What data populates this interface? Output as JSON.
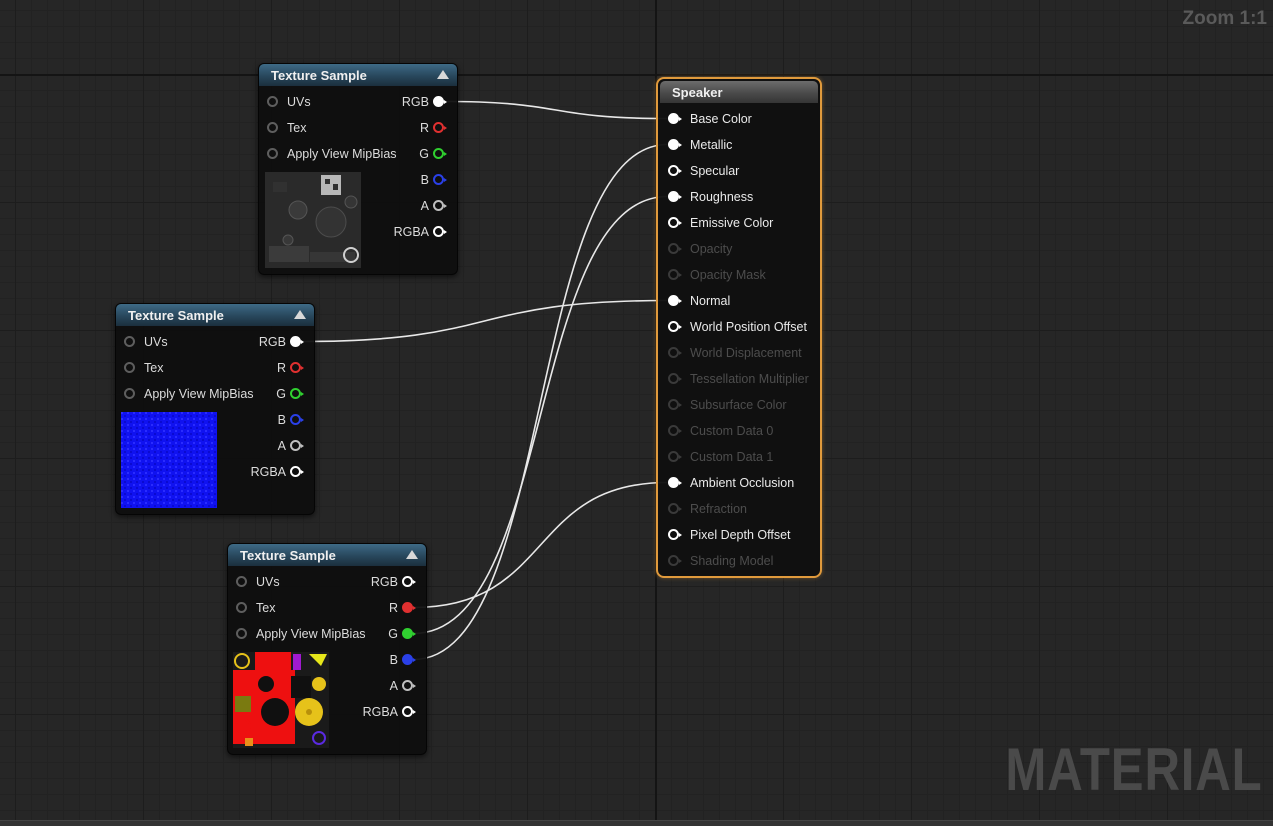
{
  "zoom_label": "Zoom 1:1",
  "watermark": "MATERIAL",
  "texture_nodes": [
    {
      "title": "Texture Sample",
      "inputs": [
        "UVs",
        "Tex",
        "Apply View MipBias"
      ],
      "outputs": [
        {
          "label": "RGB",
          "color": "#ffffff",
          "connected": true
        },
        {
          "label": "R",
          "color": "#e03030",
          "connected": false
        },
        {
          "label": "G",
          "color": "#30d030",
          "connected": false
        },
        {
          "label": "B",
          "color": "#2a40e8",
          "connected": false
        },
        {
          "label": "A",
          "color": "#bfbfbf",
          "connected": false
        },
        {
          "label": "RGBA",
          "color": "#ffffff",
          "connected": false
        }
      ],
      "thumbnail": "grayscale-normal-map"
    },
    {
      "title": "Texture Sample",
      "inputs": [
        "UVs",
        "Tex",
        "Apply View MipBias"
      ],
      "outputs": [
        {
          "label": "RGB",
          "color": "#ffffff",
          "connected": true
        },
        {
          "label": "R",
          "color": "#e03030",
          "connected": false
        },
        {
          "label": "G",
          "color": "#30d030",
          "connected": false
        },
        {
          "label": "B",
          "color": "#2a40e8",
          "connected": false
        },
        {
          "label": "A",
          "color": "#bfbfbf",
          "connected": false
        },
        {
          "label": "RGBA",
          "color": "#ffffff",
          "connected": false
        }
      ],
      "thumbnail": "blue-texture"
    },
    {
      "title": "Texture Sample",
      "inputs": [
        "UVs",
        "Tex",
        "Apply View MipBias"
      ],
      "outputs": [
        {
          "label": "RGB",
          "color": "#ffffff",
          "connected": false
        },
        {
          "label": "R",
          "color": "#e03030",
          "connected": true
        },
        {
          "label": "G",
          "color": "#30d030",
          "connected": true
        },
        {
          "label": "B",
          "color": "#2a40e8",
          "connected": true
        },
        {
          "label": "A",
          "color": "#bfbfbf",
          "connected": false
        },
        {
          "label": "RGBA",
          "color": "#ffffff",
          "connected": false
        }
      ],
      "thumbnail": "red-packed-texture"
    }
  ],
  "speaker": {
    "title": "Speaker",
    "accent": "#e09a3c",
    "inputs": [
      {
        "label": "Base Color",
        "enabled": true,
        "connected": true
      },
      {
        "label": "Metallic",
        "enabled": true,
        "connected": true
      },
      {
        "label": "Specular",
        "enabled": true,
        "connected": false
      },
      {
        "label": "Roughness",
        "enabled": true,
        "connected": true
      },
      {
        "label": "Emissive Color",
        "enabled": true,
        "connected": false
      },
      {
        "label": "Opacity",
        "enabled": false,
        "connected": false
      },
      {
        "label": "Opacity Mask",
        "enabled": false,
        "connected": false
      },
      {
        "label": "Normal",
        "enabled": true,
        "connected": true
      },
      {
        "label": "World Position Offset",
        "enabled": true,
        "connected": false
      },
      {
        "label": "World Displacement",
        "enabled": false,
        "connected": false
      },
      {
        "label": "Tessellation Multiplier",
        "enabled": false,
        "connected": false
      },
      {
        "label": "Subsurface Color",
        "enabled": false,
        "connected": false
      },
      {
        "label": "Custom Data 0",
        "enabled": false,
        "connected": false
      },
      {
        "label": "Custom Data 1",
        "enabled": false,
        "connected": false
      },
      {
        "label": "Ambient Occlusion",
        "enabled": true,
        "connected": true
      },
      {
        "label": "Refraction",
        "enabled": false,
        "connected": false
      },
      {
        "label": "Pixel Depth Offset",
        "enabled": true,
        "connected": false
      },
      {
        "label": "Shading Model",
        "enabled": false,
        "connected": false
      }
    ]
  },
  "connections": [
    {
      "from_node": 0,
      "from_pin": "RGB",
      "to_input": "Base Color"
    },
    {
      "from_node": 1,
      "from_pin": "RGB",
      "to_input": "Normal"
    },
    {
      "from_node": 2,
      "from_pin": "R",
      "to_input": "Ambient Occlusion"
    },
    {
      "from_node": 2,
      "from_pin": "G",
      "to_input": "Roughness"
    },
    {
      "from_node": 2,
      "from_pin": "B",
      "to_input": "Metallic"
    }
  ]
}
